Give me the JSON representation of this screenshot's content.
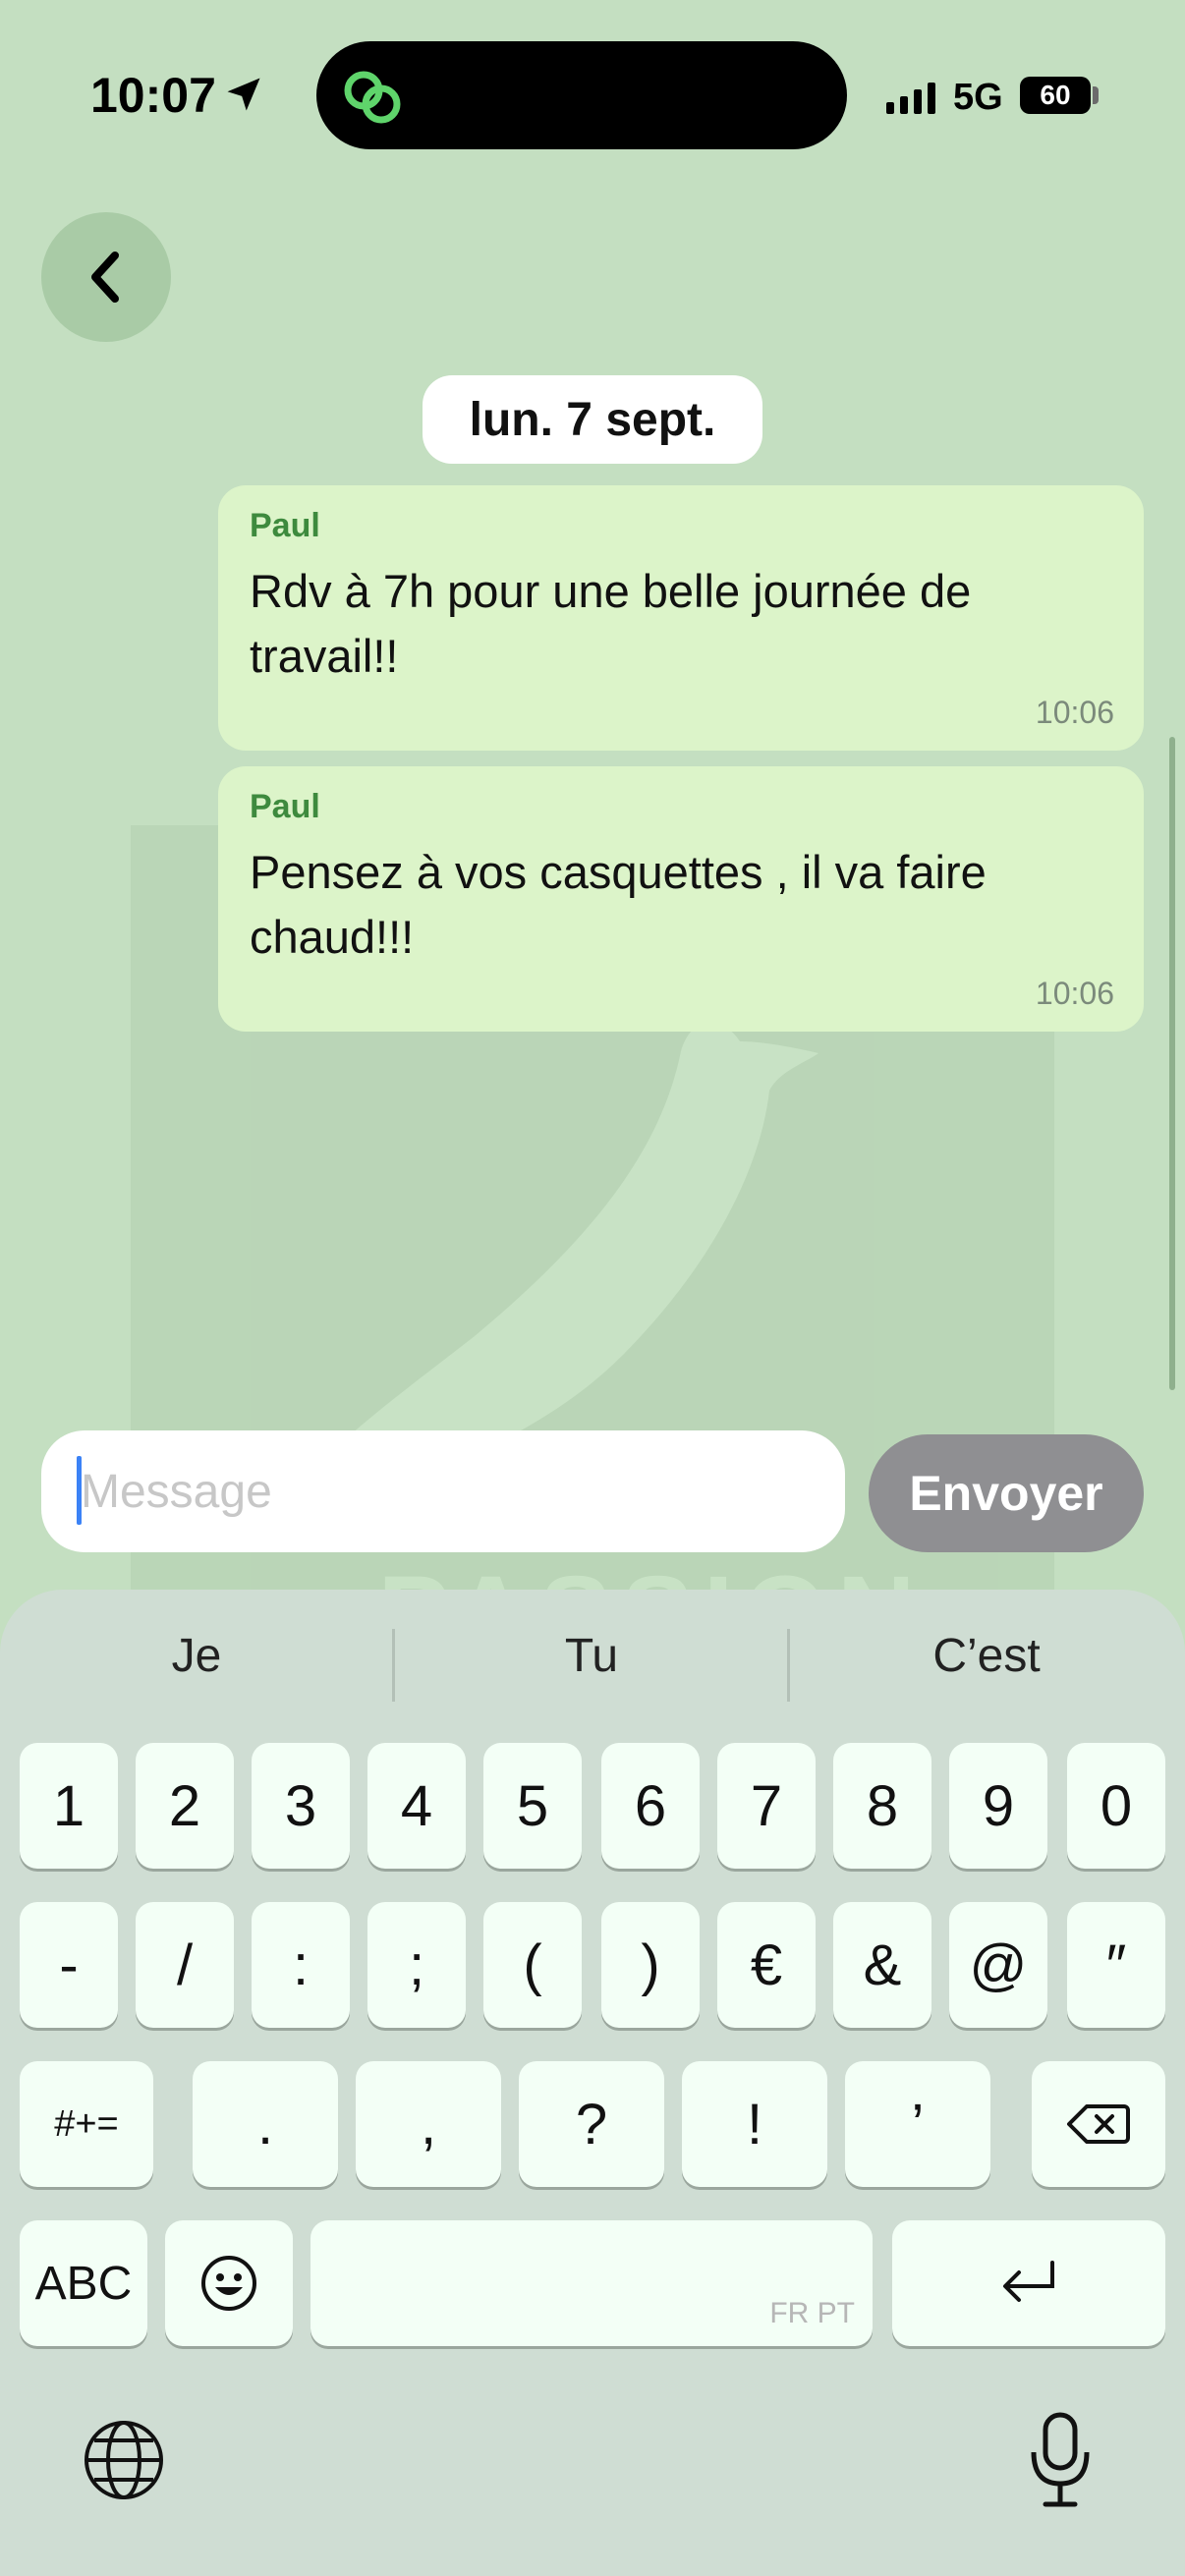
{
  "status_bar": {
    "time": "10:07",
    "network": "5G",
    "battery": "60"
  },
  "chat": {
    "date": "lun. 7 sept.",
    "messages": [
      {
        "sender": "Paul",
        "text": "Rdv à 7h pour une belle journée de travail!!",
        "time": "10:06"
      },
      {
        "sender": "Paul",
        "text": "Pensez à vos casquettes , il va faire chaud!!!",
        "time": "10:06"
      }
    ]
  },
  "composer": {
    "placeholder": "Message",
    "send_label": "Envoyer"
  },
  "keyboard": {
    "suggestions": [
      "Je",
      "Tu",
      "C’est"
    ],
    "row1": [
      "1",
      "2",
      "3",
      "4",
      "5",
      "6",
      "7",
      "8",
      "9",
      "0"
    ],
    "row2": [
      "-",
      "/",
      ":",
      ";",
      "(",
      ")",
      "€",
      "&",
      "@",
      "″"
    ],
    "row3": [
      "#+=",
      ".",
      ",",
      "?",
      "!",
      "’"
    ],
    "abc_label": "ABC",
    "space_lang": "FR PT"
  },
  "colors": {
    "background": "#c4dfc1",
    "bubble": "#dcf4c9",
    "sender": "#3e8a3e",
    "send_button": "#8f8f92"
  },
  "watermark_text": "PASSION"
}
